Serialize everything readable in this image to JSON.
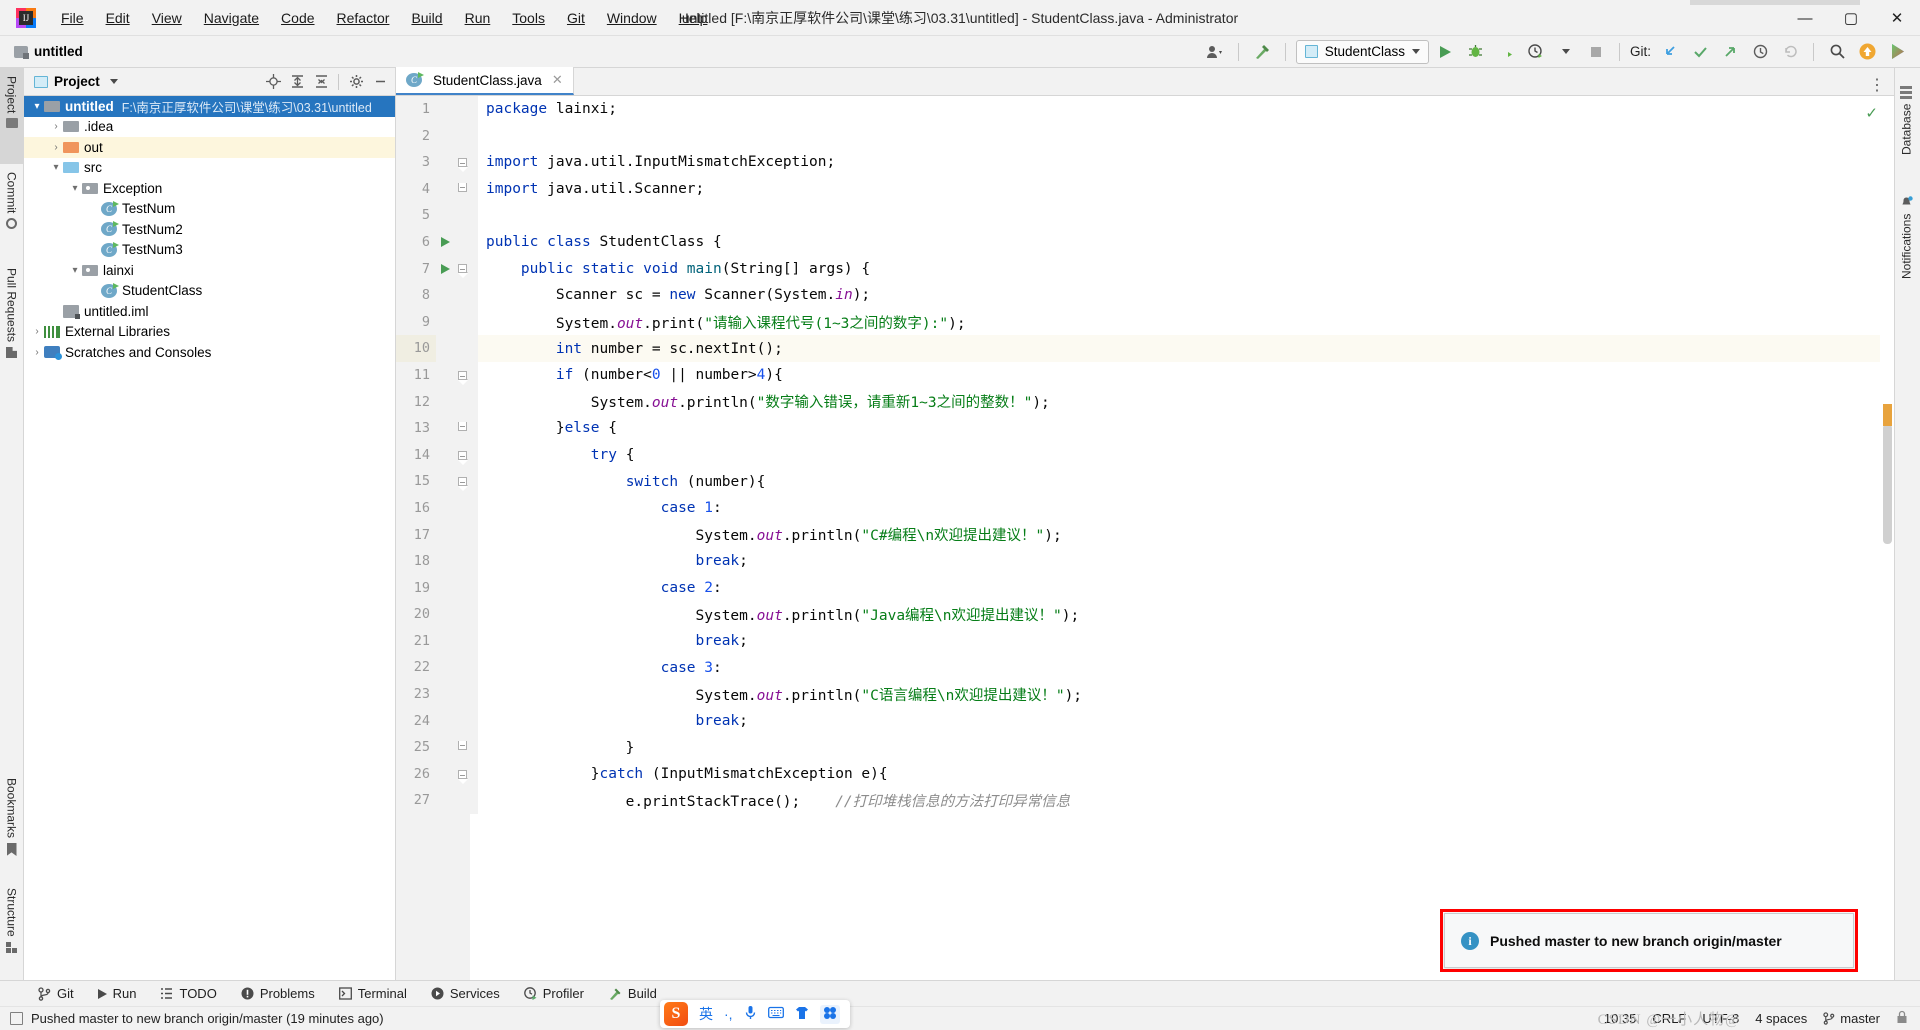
{
  "window": {
    "title": "untitled [F:\\南京正厚软件公司\\课堂\\练习\\03.31\\untitled] - StudentClass.java - Administrator",
    "minimize": "—",
    "maximize": "▢",
    "close": "✕"
  },
  "menu": {
    "items": [
      "File",
      "Edit",
      "View",
      "Navigate",
      "Code",
      "Refactor",
      "Build",
      "Run",
      "Tools",
      "Git",
      "Window",
      "Help"
    ]
  },
  "toolbar": {
    "project_name": "untitled",
    "run_config": "StudentClass",
    "git_label": "Git:",
    "icons": [
      "user-avatar-icon",
      "build-hammer-icon",
      "run-icon",
      "debug-icon",
      "run-coverage-icon",
      "profiler-icon",
      "stop-icon",
      "git-update-icon",
      "git-commit-icon",
      "git-push-icon",
      "git-history-icon",
      "git-rollback-icon",
      "search-everywhere-icon",
      "ide-update-icon",
      "feedback-icon"
    ]
  },
  "left_strip": {
    "items": [
      {
        "label": "Project",
        "icon": "project-folder-icon",
        "selected": true
      },
      {
        "label": "Commit",
        "icon": "commit-icon",
        "selected": false
      },
      {
        "label": "Pull Requests",
        "icon": "pull-request-icon",
        "selected": false
      }
    ],
    "bottom_items": [
      {
        "label": "Bookmarks",
        "icon": "bookmark-icon"
      },
      {
        "label": "Structure",
        "icon": "structure-icon"
      }
    ]
  },
  "right_strip": {
    "items": [
      {
        "label": "Database",
        "icon": "database-icon"
      },
      {
        "label": "Notifications",
        "icon": "notification-bell-icon"
      }
    ]
  },
  "project_panel": {
    "title": "Project",
    "header_icons": [
      "locate-target-icon",
      "expand-all-icon",
      "collapse-all-icon",
      "settings-gear-icon",
      "hide-minimize-icon"
    ],
    "tree": [
      {
        "depth": 0,
        "arrow": "▾",
        "icon": "folder-module-icon",
        "name": "untitled",
        "bold": true,
        "path": "F:\\南京正厚软件公司\\课堂\\练习\\03.31\\untitled",
        "state": "selected"
      },
      {
        "depth": 1,
        "arrow": "›",
        "icon": "folder-icon",
        "name": ".idea",
        "bold": false,
        "path": "",
        "state": "normal"
      },
      {
        "depth": 1,
        "arrow": "›",
        "icon": "folder-excluded-icon",
        "name": "out",
        "bold": false,
        "path": "",
        "state": "highlighted"
      },
      {
        "depth": 1,
        "arrow": "▾",
        "icon": "folder-source-icon",
        "name": "src",
        "bold": false,
        "path": "",
        "state": "normal"
      },
      {
        "depth": 2,
        "arrow": "▾",
        "icon": "package-icon",
        "name": "Exception",
        "bold": false,
        "path": "",
        "state": "normal"
      },
      {
        "depth": 3,
        "arrow": "",
        "icon": "java-class-icon",
        "name": "TestNum",
        "bold": false,
        "path": "",
        "state": "normal"
      },
      {
        "depth": 3,
        "arrow": "",
        "icon": "java-class-icon",
        "name": "TestNum2",
        "bold": false,
        "path": "",
        "state": "normal"
      },
      {
        "depth": 3,
        "arrow": "",
        "icon": "java-class-icon",
        "name": "TestNum3",
        "bold": false,
        "path": "",
        "state": "normal"
      },
      {
        "depth": 2,
        "arrow": "▾",
        "icon": "package-icon",
        "name": "lainxi",
        "bold": false,
        "path": "",
        "state": "normal"
      },
      {
        "depth": 3,
        "arrow": "",
        "icon": "java-class-icon",
        "name": "StudentClass",
        "bold": false,
        "path": "",
        "state": "normal"
      },
      {
        "depth": 1,
        "arrow": "",
        "icon": "iml-file-icon",
        "name": "untitled.iml",
        "bold": false,
        "path": "",
        "state": "normal"
      },
      {
        "depth": 0,
        "arrow": "›",
        "icon": "external-libraries-icon",
        "name": "External Libraries",
        "bold": false,
        "path": "",
        "state": "normal"
      },
      {
        "depth": 0,
        "arrow": "›",
        "icon": "scratches-icon",
        "name": "Scratches and Consoles",
        "bold": false,
        "path": "",
        "state": "normal"
      }
    ]
  },
  "editor": {
    "tab": {
      "label": "StudentClass.java",
      "icon": "java-class-icon",
      "close": "✕"
    },
    "lines": [
      {
        "n": "1",
        "run": false,
        "fold": "",
        "hl": false,
        "tokens": [
          {
            "t": "kw",
            "v": "package"
          },
          {
            "t": "pln",
            "v": " lainxi;"
          }
        ]
      },
      {
        "n": "2",
        "run": false,
        "fold": "",
        "hl": false,
        "tokens": []
      },
      {
        "n": "3",
        "run": false,
        "fold": "down",
        "hl": false,
        "tokens": [
          {
            "t": "kw",
            "v": "import"
          },
          {
            "t": "pln",
            "v": " java.util.InputMismatchException;"
          }
        ]
      },
      {
        "n": "4",
        "run": false,
        "fold": "up",
        "hl": false,
        "tokens": [
          {
            "t": "kw",
            "v": "import"
          },
          {
            "t": "pln",
            "v": " java.util.Scanner;"
          }
        ]
      },
      {
        "n": "5",
        "run": false,
        "fold": "",
        "hl": false,
        "tokens": []
      },
      {
        "n": "6",
        "run": true,
        "fold": "",
        "hl": false,
        "tokens": [
          {
            "t": "kw",
            "v": "public class"
          },
          {
            "t": "pln",
            "v": " StudentClass {"
          }
        ]
      },
      {
        "n": "7",
        "run": true,
        "fold": "down",
        "hl": false,
        "tokens": [
          {
            "t": "pln",
            "v": "    "
          },
          {
            "t": "kw",
            "v": "public static void"
          },
          {
            "t": "pln",
            "v": " "
          },
          {
            "t": "mth",
            "v": "main"
          },
          {
            "t": "pln",
            "v": "(String[] args) {"
          }
        ]
      },
      {
        "n": "8",
        "run": false,
        "fold": "",
        "hl": false,
        "tokens": [
          {
            "t": "pln",
            "v": "        Scanner sc = "
          },
          {
            "t": "kw",
            "v": "new"
          },
          {
            "t": "pln",
            "v": " Scanner(System."
          },
          {
            "t": "fld",
            "v": "in"
          },
          {
            "t": "pln",
            "v": ");"
          }
        ]
      },
      {
        "n": "9",
        "run": false,
        "fold": "",
        "hl": false,
        "tokens": [
          {
            "t": "pln",
            "v": "        System."
          },
          {
            "t": "fld",
            "v": "out"
          },
          {
            "t": "pln",
            "v": ".print("
          },
          {
            "t": "str",
            "v": "\"请输入课程代号(1~3之间的数字):\""
          },
          {
            "t": "pln",
            "v": ");"
          }
        ]
      },
      {
        "n": "10",
        "run": false,
        "fold": "",
        "hl": true,
        "tokens": [
          {
            "t": "pln",
            "v": "        "
          },
          {
            "t": "kw",
            "v": "int"
          },
          {
            "t": "pln",
            "v": " number = sc.nextInt();"
          }
        ]
      },
      {
        "n": "11",
        "run": false,
        "fold": "down",
        "hl": false,
        "tokens": [
          {
            "t": "pln",
            "v": "        "
          },
          {
            "t": "kw",
            "v": "if"
          },
          {
            "t": "pln",
            "v": " (number<"
          },
          {
            "t": "num",
            "v": "0"
          },
          {
            "t": "pln",
            "v": " || number>"
          },
          {
            "t": "num",
            "v": "4"
          },
          {
            "t": "pln",
            "v": "){"
          }
        ]
      },
      {
        "n": "12",
        "run": false,
        "fold": "",
        "hl": false,
        "tokens": [
          {
            "t": "pln",
            "v": "            System."
          },
          {
            "t": "fld",
            "v": "out"
          },
          {
            "t": "pln",
            "v": ".println("
          },
          {
            "t": "str",
            "v": "\"数字输入错误，请重新1~3之间的整数！\""
          },
          {
            "t": "pln",
            "v": ");"
          }
        ]
      },
      {
        "n": "13",
        "run": false,
        "fold": "up",
        "hl": false,
        "tokens": [
          {
            "t": "pln",
            "v": "        }"
          },
          {
            "t": "kw",
            "v": "else"
          },
          {
            "t": "pln",
            "v": " {"
          }
        ]
      },
      {
        "n": "14",
        "run": false,
        "fold": "down",
        "hl": false,
        "tokens": [
          {
            "t": "pln",
            "v": "            "
          },
          {
            "t": "kw",
            "v": "try"
          },
          {
            "t": "pln",
            "v": " {"
          }
        ]
      },
      {
        "n": "15",
        "run": false,
        "fold": "down",
        "hl": false,
        "tokens": [
          {
            "t": "pln",
            "v": "                "
          },
          {
            "t": "kw",
            "v": "switch"
          },
          {
            "t": "pln",
            "v": " (number){"
          }
        ]
      },
      {
        "n": "16",
        "run": false,
        "fold": "",
        "hl": false,
        "tokens": [
          {
            "t": "pln",
            "v": "                    "
          },
          {
            "t": "kw",
            "v": "case"
          },
          {
            "t": "pln",
            "v": " "
          },
          {
            "t": "num",
            "v": "1"
          },
          {
            "t": "pln",
            "v": ":"
          }
        ]
      },
      {
        "n": "17",
        "run": false,
        "fold": "",
        "hl": false,
        "tokens": [
          {
            "t": "pln",
            "v": "                        System."
          },
          {
            "t": "fld",
            "v": "out"
          },
          {
            "t": "pln",
            "v": ".println("
          },
          {
            "t": "str",
            "v": "\"C#编程\\n欢迎提出建议！\""
          },
          {
            "t": "pln",
            "v": ");"
          }
        ]
      },
      {
        "n": "18",
        "run": false,
        "fold": "",
        "hl": false,
        "tokens": [
          {
            "t": "pln",
            "v": "                        "
          },
          {
            "t": "kw",
            "v": "break"
          },
          {
            "t": "pln",
            "v": ";"
          }
        ]
      },
      {
        "n": "19",
        "run": false,
        "fold": "",
        "hl": false,
        "tokens": [
          {
            "t": "pln",
            "v": "                    "
          },
          {
            "t": "kw",
            "v": "case"
          },
          {
            "t": "pln",
            "v": " "
          },
          {
            "t": "num",
            "v": "2"
          },
          {
            "t": "pln",
            "v": ":"
          }
        ]
      },
      {
        "n": "20",
        "run": false,
        "fold": "",
        "hl": false,
        "tokens": [
          {
            "t": "pln",
            "v": "                        System."
          },
          {
            "t": "fld",
            "v": "out"
          },
          {
            "t": "pln",
            "v": ".println("
          },
          {
            "t": "str",
            "v": "\"Java编程\\n欢迎提出建议！\""
          },
          {
            "t": "pln",
            "v": ");"
          }
        ]
      },
      {
        "n": "21",
        "run": false,
        "fold": "",
        "hl": false,
        "tokens": [
          {
            "t": "pln",
            "v": "                        "
          },
          {
            "t": "kw",
            "v": "break"
          },
          {
            "t": "pln",
            "v": ";"
          }
        ]
      },
      {
        "n": "22",
        "run": false,
        "fold": "",
        "hl": false,
        "tokens": [
          {
            "t": "pln",
            "v": "                    "
          },
          {
            "t": "kw",
            "v": "case"
          },
          {
            "t": "pln",
            "v": " "
          },
          {
            "t": "num",
            "v": "3"
          },
          {
            "t": "pln",
            "v": ":"
          }
        ]
      },
      {
        "n": "23",
        "run": false,
        "fold": "",
        "hl": false,
        "tokens": [
          {
            "t": "pln",
            "v": "                        System."
          },
          {
            "t": "fld",
            "v": "out"
          },
          {
            "t": "pln",
            "v": ".println("
          },
          {
            "t": "str",
            "v": "\"C语言编程\\n欢迎提出建议！\""
          },
          {
            "t": "pln",
            "v": ");"
          }
        ]
      },
      {
        "n": "24",
        "run": false,
        "fold": "",
        "hl": false,
        "tokens": [
          {
            "t": "pln",
            "v": "                        "
          },
          {
            "t": "kw",
            "v": "break"
          },
          {
            "t": "pln",
            "v": ";"
          }
        ]
      },
      {
        "n": "25",
        "run": false,
        "fold": "up",
        "hl": false,
        "tokens": [
          {
            "t": "pln",
            "v": "                }"
          }
        ]
      },
      {
        "n": "26",
        "run": false,
        "fold": "down",
        "hl": false,
        "tokens": [
          {
            "t": "pln",
            "v": "            }"
          },
          {
            "t": "kw",
            "v": "catch"
          },
          {
            "t": "pln",
            "v": " (InputMismatchException e){"
          }
        ]
      },
      {
        "n": "27",
        "run": false,
        "fold": "",
        "hl": false,
        "tokens": [
          {
            "t": "pln",
            "v": "                e.printStackTrace();    "
          },
          {
            "t": "cmt",
            "v": "//打印堆栈信息的方法打印异常信息"
          }
        ]
      }
    ]
  },
  "notification": {
    "text": "Pushed master to new branch origin/master",
    "icon": "info-icon"
  },
  "bottom_bar": {
    "items": [
      {
        "label": "Git",
        "icon": "git-branch-icon"
      },
      {
        "label": "Run",
        "icon": "run-icon"
      },
      {
        "label": "TODO",
        "icon": "todo-list-icon"
      },
      {
        "label": "Problems",
        "icon": "problems-icon"
      },
      {
        "label": "Terminal",
        "icon": "terminal-icon"
      },
      {
        "label": "Services",
        "icon": "services-icon"
      },
      {
        "label": "Profiler",
        "icon": "profiler-icon"
      },
      {
        "label": "Build",
        "icon": "build-hammer-icon"
      }
    ]
  },
  "status_bar": {
    "message": "Pushed master to new branch origin/master (19 minutes ago)",
    "time": "10:35",
    "line_separator": "CRLF",
    "encoding": "UTF-8",
    "indent": "4 spaces",
    "branch": "master",
    "message_icon": "event-log-icon",
    "branch_icon": "git-branch-icon",
    "lock_icon": "lock-icon"
  },
  "ime": {
    "logo": "S",
    "mode": "英",
    "items": [
      "·,",
      "mic-icon",
      "keyboard-icon",
      "skin-icon",
      "toolbox-icon"
    ]
  },
  "watermark": {
    "text": "CSDN @一小人物@"
  },
  "colors": {
    "accent": "#2675bf",
    "selection": "#2675bf",
    "highlight_row": "#fdf6dd",
    "caret_row": "#fcfaf2",
    "keyword": "#0033b3",
    "string": "#067d17",
    "number": "#1750eb",
    "field": "#871094",
    "method": "#00627a",
    "comment": "#8c8c8c",
    "notification_border": "#ff0000",
    "run_green": "#499c54"
  }
}
